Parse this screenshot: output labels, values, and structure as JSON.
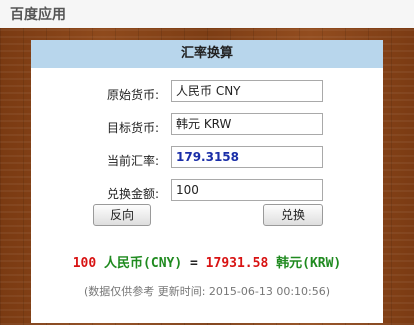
{
  "header": {
    "title": "百度应用"
  },
  "card": {
    "title": "汇率换算",
    "source_label": "原始货币:",
    "source_value": "人民币 CNY",
    "target_label": "目标货币:",
    "target_value": "韩元 KRW",
    "rate_label": "当前汇率:",
    "rate_value": "179.3158",
    "amount_label": "兑换金额:",
    "amount_value": "100",
    "reverse_button": "反向",
    "convert_button": "兑换"
  },
  "result": {
    "from_amount": "100",
    "from_currency": "人民币(CNY)",
    "equals": "=",
    "to_amount": "17931.58",
    "to_currency": "韩元(KRW)"
  },
  "note": "(数据仅供参考  更新时间: 2015-06-13 00:10:56)",
  "colors": {
    "header_bar": "#b8d6ec",
    "amount_red": "#d81313",
    "currency_green": "#1f8a1f",
    "rate_blue": "#1a2ea8",
    "wood": "#8f4a1c"
  }
}
